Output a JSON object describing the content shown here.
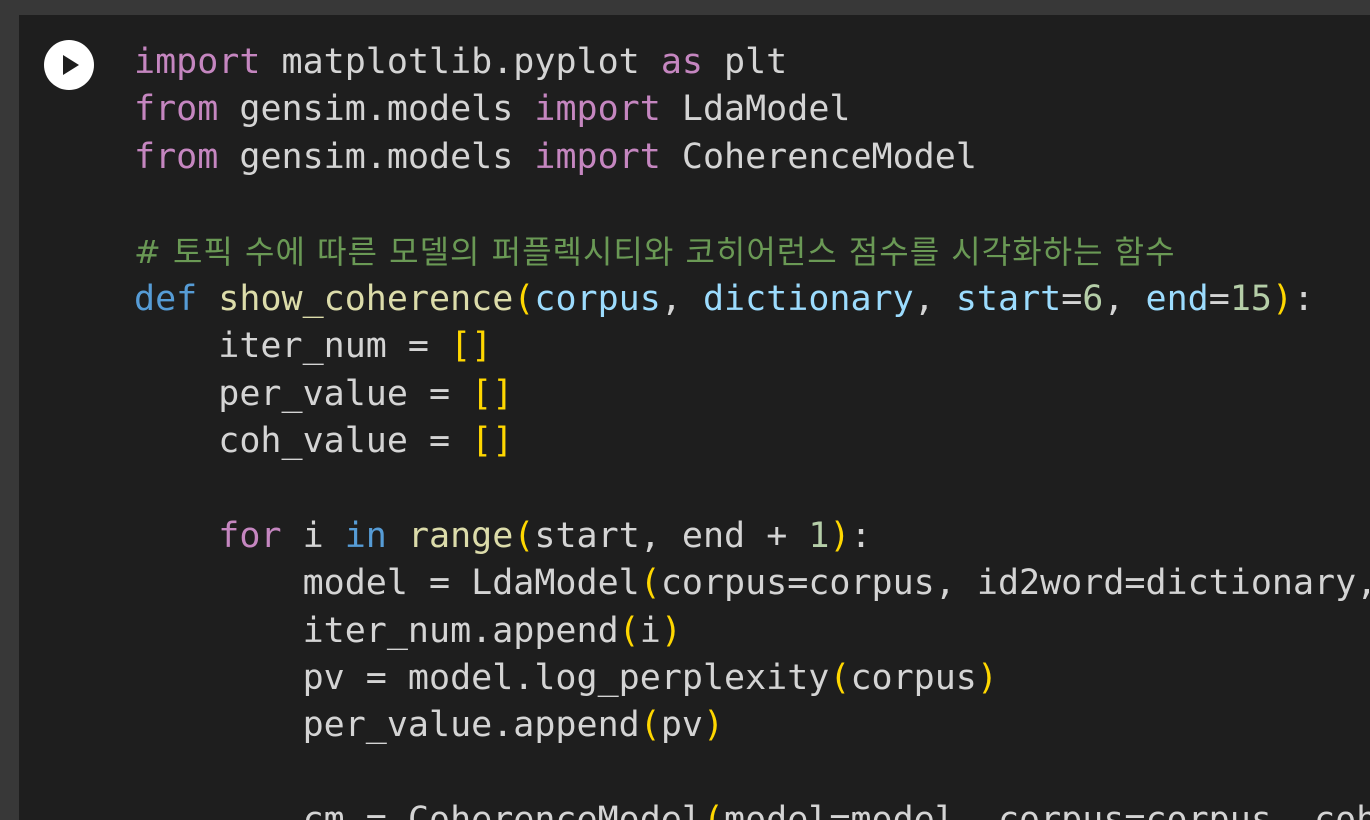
{
  "cell": {
    "run_button_label": "Run cell"
  },
  "code_lines": [
    [
      {
        "t": "import",
        "c": "kw"
      },
      {
        "t": " matplotlib.pyplot ",
        "c": "txt"
      },
      {
        "t": "as",
        "c": "kw"
      },
      {
        "t": " plt",
        "c": "txt"
      }
    ],
    [
      {
        "t": "from",
        "c": "kw"
      },
      {
        "t": " gensim.models ",
        "c": "txt"
      },
      {
        "t": "import",
        "c": "kw"
      },
      {
        "t": " LdaModel",
        "c": "txt"
      }
    ],
    [
      {
        "t": "from",
        "c": "kw"
      },
      {
        "t": " gensim.models ",
        "c": "txt"
      },
      {
        "t": "import",
        "c": "kw"
      },
      {
        "t": " CoherenceModel",
        "c": "txt"
      }
    ],
    [],
    [
      {
        "t": "# 토픽 수에 따른 모델의 퍼플렉시티와 코히어런스 점수를 시각화하는 함수",
        "c": "cm"
      }
    ],
    [
      {
        "t": "def",
        "c": "def"
      },
      {
        "t": " ",
        "c": "txt"
      },
      {
        "t": "show_coherence",
        "c": "fn"
      },
      {
        "t": "(",
        "c": "br"
      },
      {
        "t": "corpus",
        "c": "param"
      },
      {
        "t": ", ",
        "c": "txt"
      },
      {
        "t": "dictionary",
        "c": "param"
      },
      {
        "t": ", ",
        "c": "txt"
      },
      {
        "t": "start",
        "c": "param"
      },
      {
        "t": "=",
        "c": "txt"
      },
      {
        "t": "6",
        "c": "num"
      },
      {
        "t": ", ",
        "c": "txt"
      },
      {
        "t": "end",
        "c": "param"
      },
      {
        "t": "=",
        "c": "txt"
      },
      {
        "t": "15",
        "c": "num"
      },
      {
        "t": ")",
        "c": "br"
      },
      {
        "t": ":",
        "c": "txt"
      }
    ],
    [
      {
        "t": "    iter_num = ",
        "c": "txt"
      },
      {
        "t": "[]",
        "c": "br"
      }
    ],
    [
      {
        "t": "    per_value = ",
        "c": "txt"
      },
      {
        "t": "[]",
        "c": "br"
      }
    ],
    [
      {
        "t": "    coh_value = ",
        "c": "txt"
      },
      {
        "t": "[]",
        "c": "br"
      }
    ],
    [],
    [
      {
        "t": "    ",
        "c": "txt"
      },
      {
        "t": "for",
        "c": "kw"
      },
      {
        "t": " i ",
        "c": "txt"
      },
      {
        "t": "in",
        "c": "def"
      },
      {
        "t": " ",
        "c": "txt"
      },
      {
        "t": "range",
        "c": "fn"
      },
      {
        "t": "(",
        "c": "br"
      },
      {
        "t": "start, end + ",
        "c": "txt"
      },
      {
        "t": "1",
        "c": "num"
      },
      {
        "t": ")",
        "c": "br"
      },
      {
        "t": ":",
        "c": "txt"
      }
    ],
    [
      {
        "t": "        model = LdaModel",
        "c": "txt"
      },
      {
        "t": "(",
        "c": "br"
      },
      {
        "t": "corpus=corpus, id2word=dictionary, ",
        "c": "txt"
      }
    ],
    [
      {
        "t": "        iter_num.append",
        "c": "txt"
      },
      {
        "t": "(",
        "c": "br"
      },
      {
        "t": "i",
        "c": "txt"
      },
      {
        "t": ")",
        "c": "br"
      }
    ],
    [
      {
        "t": "        pv = model.log_perplexity",
        "c": "txt"
      },
      {
        "t": "(",
        "c": "br"
      },
      {
        "t": "corpus",
        "c": "txt"
      },
      {
        "t": ")",
        "c": "br"
      }
    ],
    [
      {
        "t": "        per_value.append",
        "c": "txt"
      },
      {
        "t": "(",
        "c": "br"
      },
      {
        "t": "pv",
        "c": "txt"
      },
      {
        "t": ")",
        "c": "br"
      }
    ],
    [],
    [
      {
        "t": "        cm = CoherenceModel",
        "c": "txt"
      },
      {
        "t": "(",
        "c": "br"
      },
      {
        "t": "model=model, corpus=corpus, coh",
        "c": "txt"
      }
    ]
  ],
  "colors": {
    "editor_bg": "#1e1e1e",
    "page_bg": "#383838",
    "keyword": "#c586c0",
    "def_keyword": "#569cd6",
    "function": "#dcdcaa",
    "parameter": "#9cdcfe",
    "number": "#b5cea8",
    "bracket": "#ffd700",
    "comment": "#6a9955",
    "text": "#d4d4d4"
  },
  "icons": {
    "run": "play-icon"
  }
}
